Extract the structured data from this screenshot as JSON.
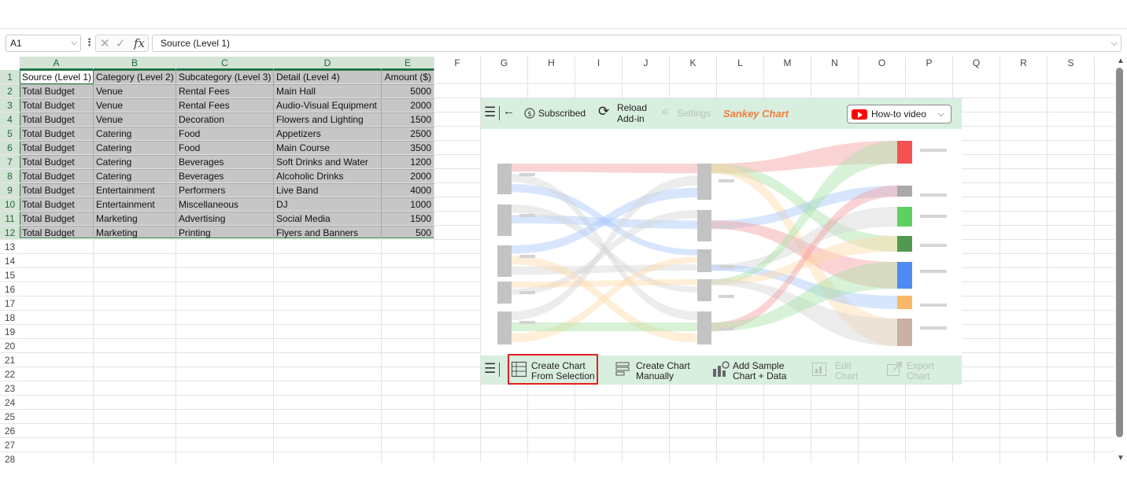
{
  "formula_bar": {
    "name_box": "A1",
    "formula": "Source (Level 1)",
    "cancel_glyph": "✕",
    "enter_glyph": "✓",
    "fx_glyph": "fx"
  },
  "columns": [
    "A",
    "B",
    "C",
    "D",
    "E",
    "F",
    "G",
    "H",
    "I",
    "J",
    "K",
    "L",
    "M",
    "N",
    "O",
    "P",
    "Q",
    "R",
    "S"
  ],
  "rows": [
    "1",
    "2",
    "3",
    "4",
    "5",
    "6",
    "7",
    "8",
    "9",
    "10",
    "11",
    "12",
    "13",
    "14",
    "15",
    "16",
    "17",
    "18",
    "19",
    "20",
    "21",
    "22",
    "23",
    "24",
    "25",
    "26",
    "27",
    "28"
  ],
  "table": {
    "headers": [
      "Source (Level 1)",
      "Category (Level 2)",
      "Subcategory (Level 3)",
      "Detail (Level 4)",
      "Amount ($)"
    ],
    "rows": [
      [
        "Total Budget",
        "Venue",
        "Rental Fees",
        "Main Hall",
        "5000"
      ],
      [
        "Total Budget",
        "Venue",
        "Rental Fees",
        "Audio-Visual Equipment",
        "2000"
      ],
      [
        "Total Budget",
        "Venue",
        "Decoration",
        "Flowers and Lighting",
        "1500"
      ],
      [
        "Total Budget",
        "Catering",
        "Food",
        "Appetizers",
        "2500"
      ],
      [
        "Total Budget",
        "Catering",
        "Food",
        "Main Course",
        "3500"
      ],
      [
        "Total Budget",
        "Catering",
        "Beverages",
        "Soft Drinks and Water",
        "1200"
      ],
      [
        "Total Budget",
        "Catering",
        "Beverages",
        "Alcoholic Drinks",
        "2000"
      ],
      [
        "Total Budget",
        "Entertainment",
        "Performers",
        "Live Band",
        "4000"
      ],
      [
        "Total Budget",
        "Entertainment",
        "Miscellaneous",
        "DJ",
        "1000"
      ],
      [
        "Total Budget",
        "Marketing",
        "Advertising",
        "Social Media",
        "1500"
      ],
      [
        "Total Budget",
        "Marketing",
        "Printing",
        "Flyers and Banners",
        "500"
      ]
    ]
  },
  "addin": {
    "top_toolbar": {
      "subscribed": "Subscribed",
      "reload_line1": "Reload",
      "reload_line2": "Add-in",
      "settings": "Settings",
      "brand": "Sankey Chart",
      "howto": "How-to video"
    },
    "bottom_toolbar": {
      "create_selection_line1": "Create Chart",
      "create_selection_line2": "From Selection",
      "create_manual_line1": "Create Chart",
      "create_manual_line2": "Manually",
      "add_sample_line1": "Add Sample",
      "add_sample_line2": "Chart + Data",
      "edit_line1": "Edit",
      "edit_line2": "Chart",
      "export_line1": "Export",
      "export_line2": "Chart"
    },
    "colors": {
      "toolbar_bg": "#d8eedf",
      "brand": "#f07e3e",
      "highlight": "#e02020"
    },
    "preview_colors": [
      "#f24040",
      "#a0a0a0",
      "#4ecb4e",
      "#3e8e3e",
      "#3b7ef5",
      "#fbb059",
      "#c4a89a"
    ]
  }
}
